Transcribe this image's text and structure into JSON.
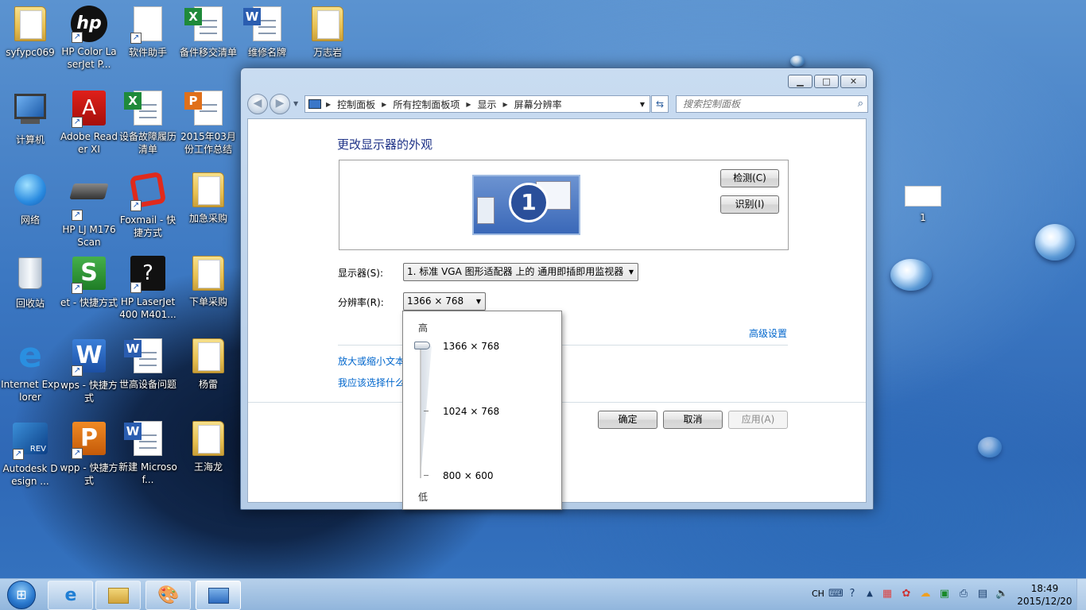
{
  "desktop": {
    "icons": [
      {
        "label": "syfypc069"
      },
      {
        "label": "HP Color LaserJet P..."
      },
      {
        "label": "软件助手"
      },
      {
        "label": "备件移交清单"
      },
      {
        "label": "维修名牌"
      },
      {
        "label": "万志岩"
      },
      {
        "label": "计算机"
      },
      {
        "label": "Adobe Reader XI"
      },
      {
        "label": "设备故障履历清单"
      },
      {
        "label": "2015年03月份工作总结"
      },
      {
        "label": "网络"
      },
      {
        "label": "HP LJ M176 Scan"
      },
      {
        "label": "Foxmail - 快捷方式"
      },
      {
        "label": "加急采购"
      },
      {
        "label": "回收站"
      },
      {
        "label": "et - 快捷方式"
      },
      {
        "label": "HP LaserJet 400 M401..."
      },
      {
        "label": "下单采购"
      },
      {
        "label": "Internet Explorer"
      },
      {
        "label": "wps - 快捷方式"
      },
      {
        "label": "世高设备问题"
      },
      {
        "label": "杨雷"
      },
      {
        "label": "Autodesk Design ..."
      },
      {
        "label": "wpp - 快捷方式"
      },
      {
        "label": "新建 Microsof..."
      },
      {
        "label": "王海龙"
      },
      {
        "label": "1"
      }
    ]
  },
  "window": {
    "breadcrumb": [
      "控制面板",
      "所有控制面板项",
      "显示",
      "屏幕分辨率"
    ],
    "search_placeholder": "搜索控制面板",
    "heading": "更改显示器的外观",
    "monitor_number": "1",
    "detect_button": "检测(C)",
    "identify_button": "识别(I)",
    "display_label": "显示器(S):",
    "display_value": "1. 标准 VGA 图形适配器 上的 通用即插即用监视器",
    "resolution_label": "分辨率(R):",
    "resolution_value": "1366 × 768",
    "advanced_link": "高级设置",
    "link1": "放大或缩小文本",
    "link2": "我应该选择什么",
    "ok_button": "确定",
    "cancel_button": "取消",
    "apply_button": "应用(A)"
  },
  "resolution_dropdown": {
    "high_label": "高",
    "low_label": "低",
    "options": [
      "1366 × 768",
      "1024 × 768",
      "800 × 600"
    ],
    "selected": "1366 × 768"
  },
  "taskbar": {
    "language": "CH",
    "time": "18:49",
    "date": "2015/12/20"
  },
  "colors": {
    "link": "#0066cc",
    "heading": "#1e3287"
  }
}
